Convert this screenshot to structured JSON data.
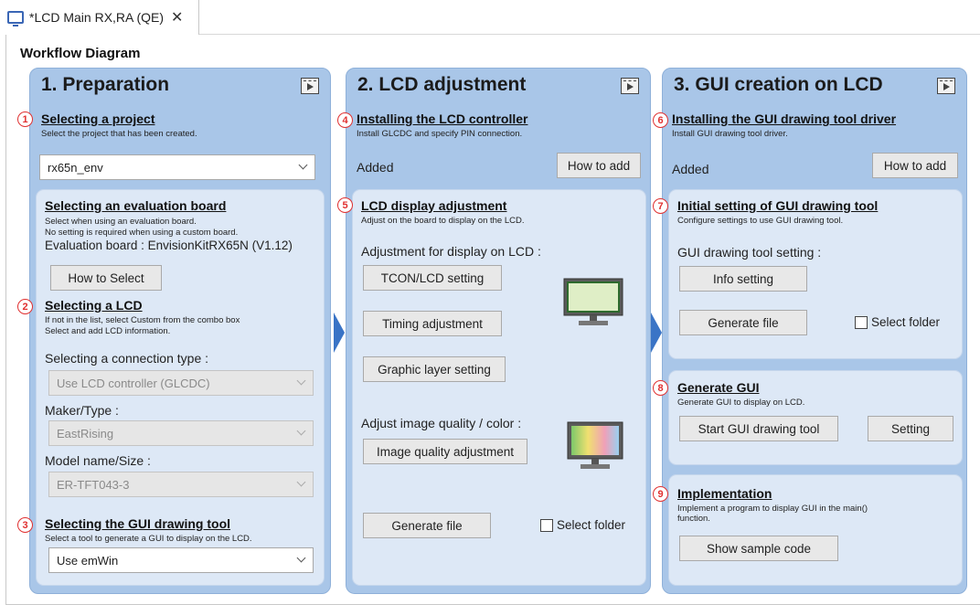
{
  "tab": {
    "title": "*LCD Main RX,RA (QE)",
    "close": "✕"
  },
  "workflow_title": "Workflow Diagram",
  "col1": {
    "title": "1. Preparation",
    "s1": {
      "num": "1",
      "heading": "Selecting a project",
      "desc": "Select the project that has been created.",
      "project_value": "rx65n_env"
    },
    "eval": {
      "heading": "Selecting an evaluation board",
      "desc1": "Select when using an evaluation board.",
      "desc2": "No setting is required when using a custom board.",
      "board_label": "Evaluation board : EnvisionKitRX65N (V1.12)",
      "how_to_select": "How to Select"
    },
    "s2": {
      "num": "2",
      "heading": "Selecting a LCD",
      "desc1": "If not in the list, select Custom from the combo box",
      "desc2": "Select and add LCD information.",
      "conn_label": "Selecting a connection type :",
      "conn_value": "Use LCD controller (GLCDC)",
      "maker_label": "Maker/Type :",
      "maker_value": "EastRising",
      "model_label": "Model name/Size :",
      "model_value": "ER-TFT043-3"
    },
    "s3": {
      "num": "3",
      "heading": "Selecting the GUI drawing tool",
      "desc": "Select a tool to generate a GUI to display on the LCD.",
      "tool_value": "Use emWin"
    }
  },
  "col2": {
    "title": "2. LCD adjustment",
    "s4": {
      "num": "4",
      "heading": "Installing the LCD controller",
      "desc": "Install GLCDC and specify PIN connection.",
      "status": "Added",
      "how_to_add": "How to add"
    },
    "s5": {
      "num": "5",
      "heading": "LCD display adjustment",
      "desc": "Adjust on the board to display on the LCD.",
      "adj_label": "Adjustment for display on LCD :",
      "tcon": "TCON/LCD setting",
      "timing": "Timing adjustment",
      "graphic": "Graphic layer setting",
      "quality_label": "Adjust image quality / color :",
      "quality_btn": "Image quality adjustment",
      "generate": "Generate file",
      "select_folder": "Select folder"
    }
  },
  "col3": {
    "title": "3. GUI creation on LCD",
    "s6": {
      "num": "6",
      "heading": "Installing the GUI drawing tool driver",
      "desc": "Install GUI drawing tool driver.",
      "status": "Added",
      "how_to_add": "How to add"
    },
    "s7": {
      "num": "7",
      "heading": "Initial setting of GUI drawing tool",
      "desc": "Configure settings to use GUI drawing tool.",
      "setting_label": "GUI drawing tool setting :",
      "info": "Info setting",
      "generate": "Generate file",
      "select_folder": "Select folder"
    },
    "s8": {
      "num": "8",
      "heading": "Generate GUI",
      "desc": "Generate GUI to display on LCD.",
      "start": "Start GUI drawing tool",
      "setting": "Setting"
    },
    "s9": {
      "num": "9",
      "heading": "Implementation",
      "desc1": "Implement a program to display GUI in the main()",
      "desc2": "function.",
      "show": "Show sample code"
    }
  },
  "icons": [
    "monitor-icon",
    "film-icon",
    "lcd-monitor-icon",
    "color-monitor-icon",
    "chevron-down-icon",
    "flow-arrow-icon"
  ]
}
